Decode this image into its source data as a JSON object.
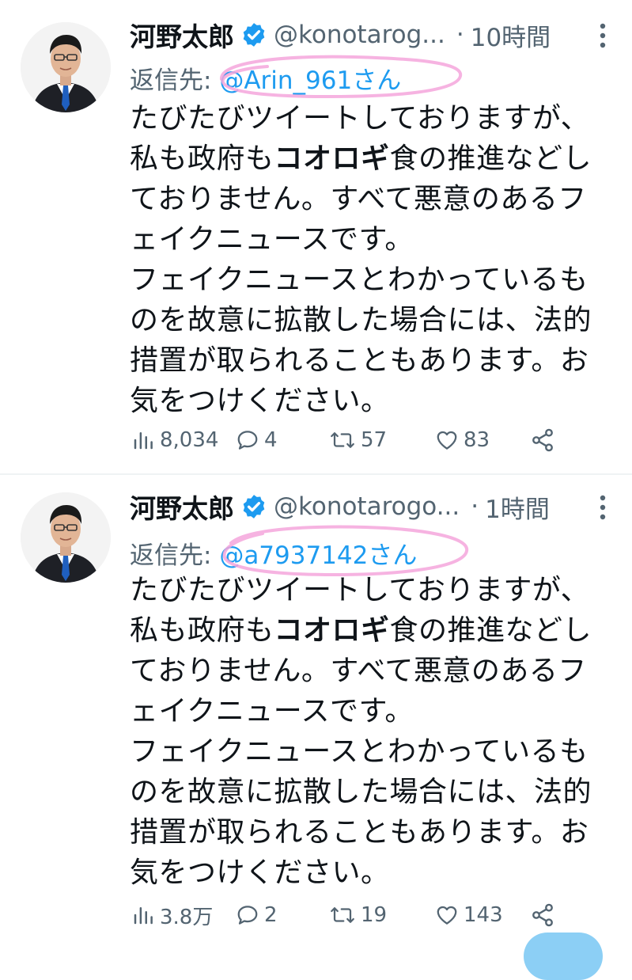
{
  "tweets": [
    {
      "display_name": "河野太郎",
      "handle": "@konotarog...",
      "separator": "·",
      "time": "10時間",
      "reply_label": "返信先:",
      "reply_to": "@Arin_961さん",
      "text_lines": [
        {
          "a": "たびたびツイートしておりますが、",
          "b": "",
          "c": ""
        },
        {
          "a": "私も政府も",
          "b": "コオロギ",
          "c": "食の推進などし"
        },
        {
          "a": "ておりません。すべて悪意のあるフ",
          "b": "",
          "c": ""
        },
        {
          "a": "ェイクニュースです。",
          "b": "",
          "c": ""
        },
        {
          "a": "フェイクニュースとわかっているも",
          "b": "",
          "c": ""
        },
        {
          "a": "のを故意に拡散した場合には、法的",
          "b": "",
          "c": ""
        },
        {
          "a": "措置が取られることもあります。お",
          "b": "",
          "c": ""
        },
        {
          "a": "気をつけください。",
          "b": "",
          "c": ""
        }
      ],
      "views": "8,034",
      "replies": "4",
      "retweets": "57",
      "likes": "83"
    },
    {
      "display_name": "河野太郎",
      "handle": "@konotarogo...",
      "separator": "·",
      "time": "1時間",
      "reply_label": "返信先:",
      "reply_to": "@a7937142さん",
      "text_lines": [
        {
          "a": "たびたびツイートしておりますが、",
          "b": "",
          "c": ""
        },
        {
          "a": "私も政府も",
          "b": "コオロギ",
          "c": "食の推進などし"
        },
        {
          "a": "ておりません。すべて悪意のあるフ",
          "b": "",
          "c": ""
        },
        {
          "a": "ェイクニュースです。",
          "b": "",
          "c": ""
        },
        {
          "a": "フェイクニュースとわかっているも",
          "b": "",
          "c": ""
        },
        {
          "a": "のを故意に拡散した場合には、法的",
          "b": "",
          "c": ""
        },
        {
          "a": "措置が取られることもあります。お",
          "b": "",
          "c": ""
        },
        {
          "a": "気をつけください。",
          "b": "",
          "c": ""
        }
      ],
      "views": "3.8万",
      "replies": "2",
      "retweets": "19",
      "likes": "143"
    }
  ],
  "icons": {
    "verified": "verified-badge-icon",
    "more": "more-vertical-icon",
    "views": "analytics-icon",
    "reply": "reply-icon",
    "retweet": "retweet-icon",
    "like": "heart-icon",
    "share": "share-icon"
  },
  "colors": {
    "accent": "#1d9bf0",
    "muted": "#536471",
    "highlight": "#f4a6dc",
    "fab": "#8ccff5"
  }
}
